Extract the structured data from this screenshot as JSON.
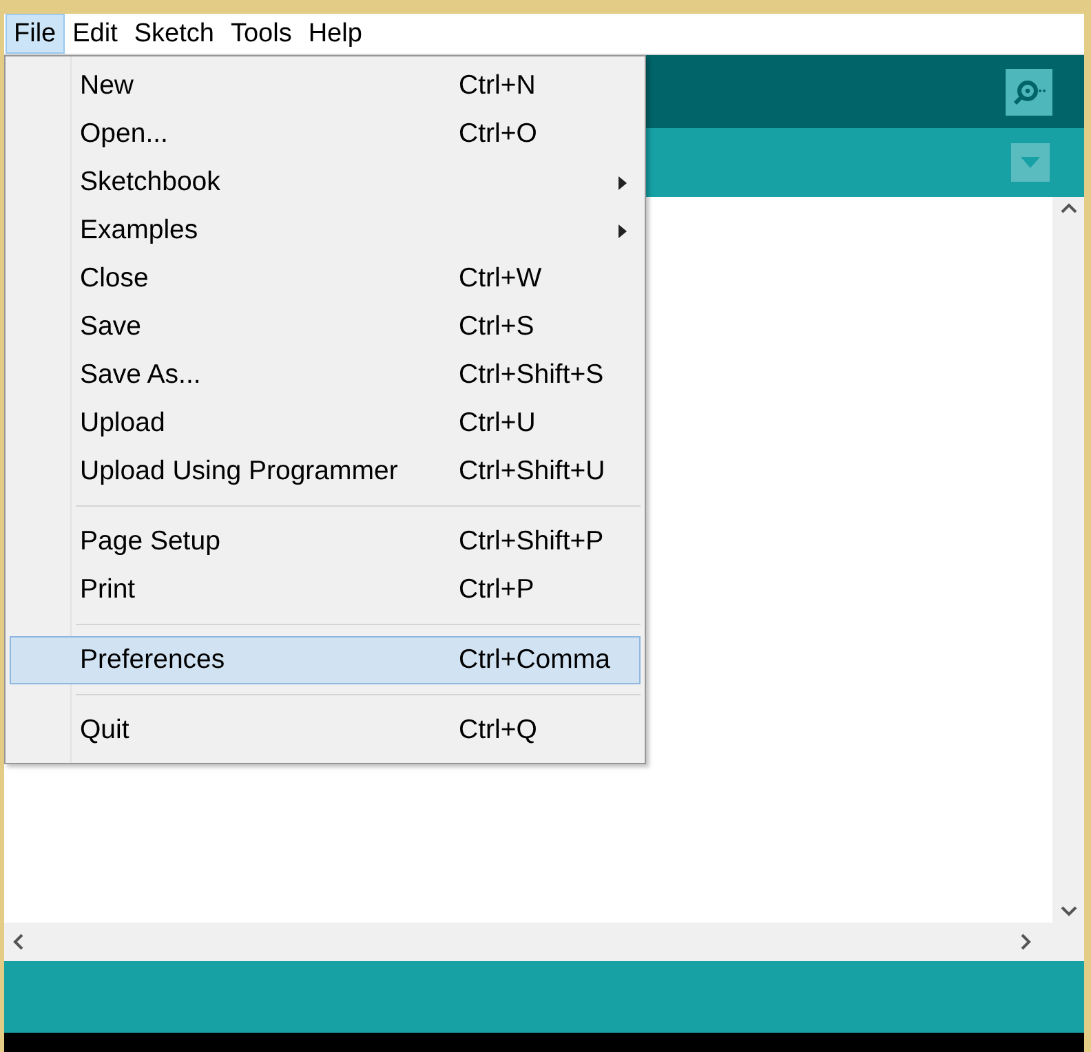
{
  "menubar": [
    {
      "label": "File",
      "selected": true
    },
    {
      "label": "Edit",
      "selected": false
    },
    {
      "label": "Sketch",
      "selected": false
    },
    {
      "label": "Tools",
      "selected": false
    },
    {
      "label": "Help",
      "selected": false
    }
  ],
  "file_menu": [
    {
      "kind": "item",
      "label": "New",
      "shortcut": "Ctrl+N",
      "submenu": false,
      "selected": false
    },
    {
      "kind": "item",
      "label": "Open...",
      "shortcut": "Ctrl+O",
      "submenu": false,
      "selected": false
    },
    {
      "kind": "item",
      "label": "Sketchbook",
      "submenu": true,
      "selected": false
    },
    {
      "kind": "item",
      "label": "Examples",
      "submenu": true,
      "selected": false
    },
    {
      "kind": "item",
      "label": "Close",
      "shortcut": "Ctrl+W",
      "submenu": false,
      "selected": false
    },
    {
      "kind": "item",
      "label": "Save",
      "shortcut": "Ctrl+S",
      "submenu": false,
      "selected": false
    },
    {
      "kind": "item",
      "label": "Save As...",
      "shortcut": "Ctrl+Shift+S",
      "submenu": false,
      "selected": false
    },
    {
      "kind": "item",
      "label": "Upload",
      "shortcut": "Ctrl+U",
      "submenu": false,
      "selected": false
    },
    {
      "kind": "item",
      "label": "Upload Using Programmer",
      "shortcut": "Ctrl+Shift+U",
      "submenu": false,
      "selected": false
    },
    {
      "kind": "separator"
    },
    {
      "kind": "item",
      "label": "Page Setup",
      "shortcut": "Ctrl+Shift+P",
      "submenu": false,
      "selected": false
    },
    {
      "kind": "item",
      "label": "Print",
      "shortcut": "Ctrl+P",
      "submenu": false,
      "selected": false
    },
    {
      "kind": "separator"
    },
    {
      "kind": "item",
      "label": "Preferences",
      "shortcut": "Ctrl+Comma",
      "submenu": false,
      "selected": true
    },
    {
      "kind": "separator"
    },
    {
      "kind": "item",
      "label": "Quit",
      "shortcut": "Ctrl+Q",
      "submenu": false,
      "selected": false
    }
  ]
}
